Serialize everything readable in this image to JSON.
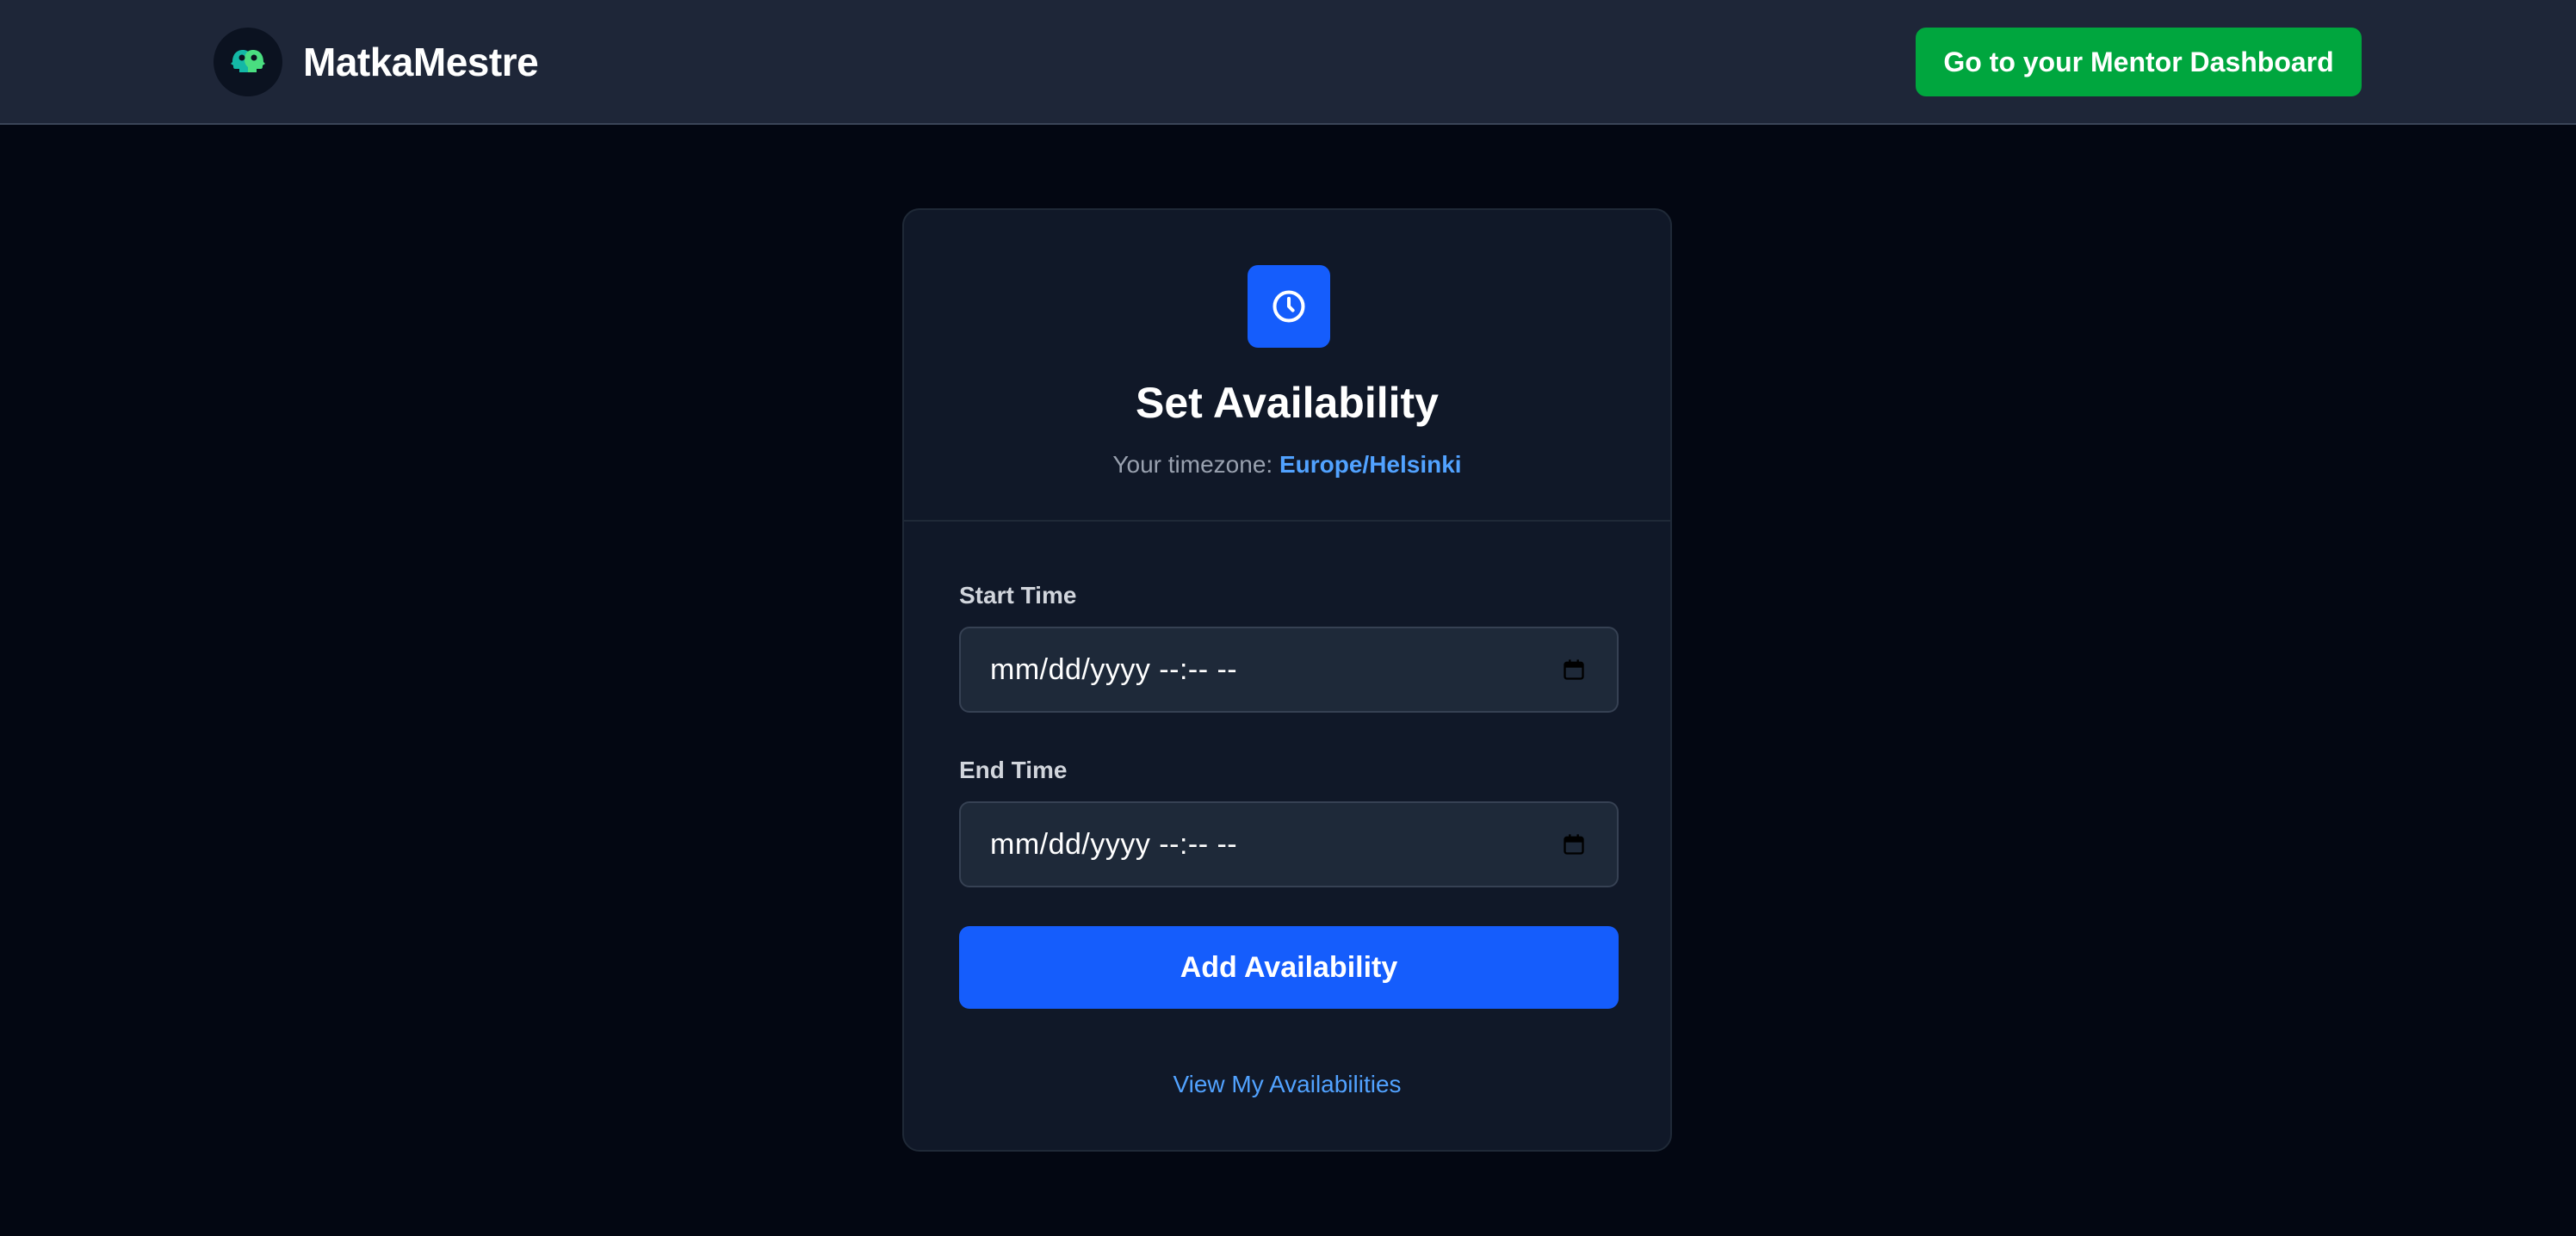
{
  "header": {
    "logo_icon": "two-heads-chat-icon",
    "brand": "MatkaMestre",
    "dashboard_button": "Go to your Mentor Dashboard"
  },
  "card": {
    "icon": "clock-icon",
    "title": "Set Availability",
    "timezone_label": "Your timezone: ",
    "timezone_value": "Europe/Helsinki",
    "start": {
      "label": "Start Time",
      "placeholder": "mm/dd/yyyy --:-- --",
      "icon": "calendar-icon"
    },
    "end": {
      "label": "End Time",
      "placeholder": "mm/dd/yyyy --:-- --",
      "icon": "calendar-icon"
    },
    "submit": "Add Availability",
    "view_link": "View My Availabilities"
  },
  "colors": {
    "page_bg": "#030712",
    "header_bg": "#1e2638",
    "card_bg": "#101828",
    "input_bg": "#1e2939",
    "primary": "#155dfc",
    "success": "#00a63e",
    "link": "#51a2ff"
  }
}
